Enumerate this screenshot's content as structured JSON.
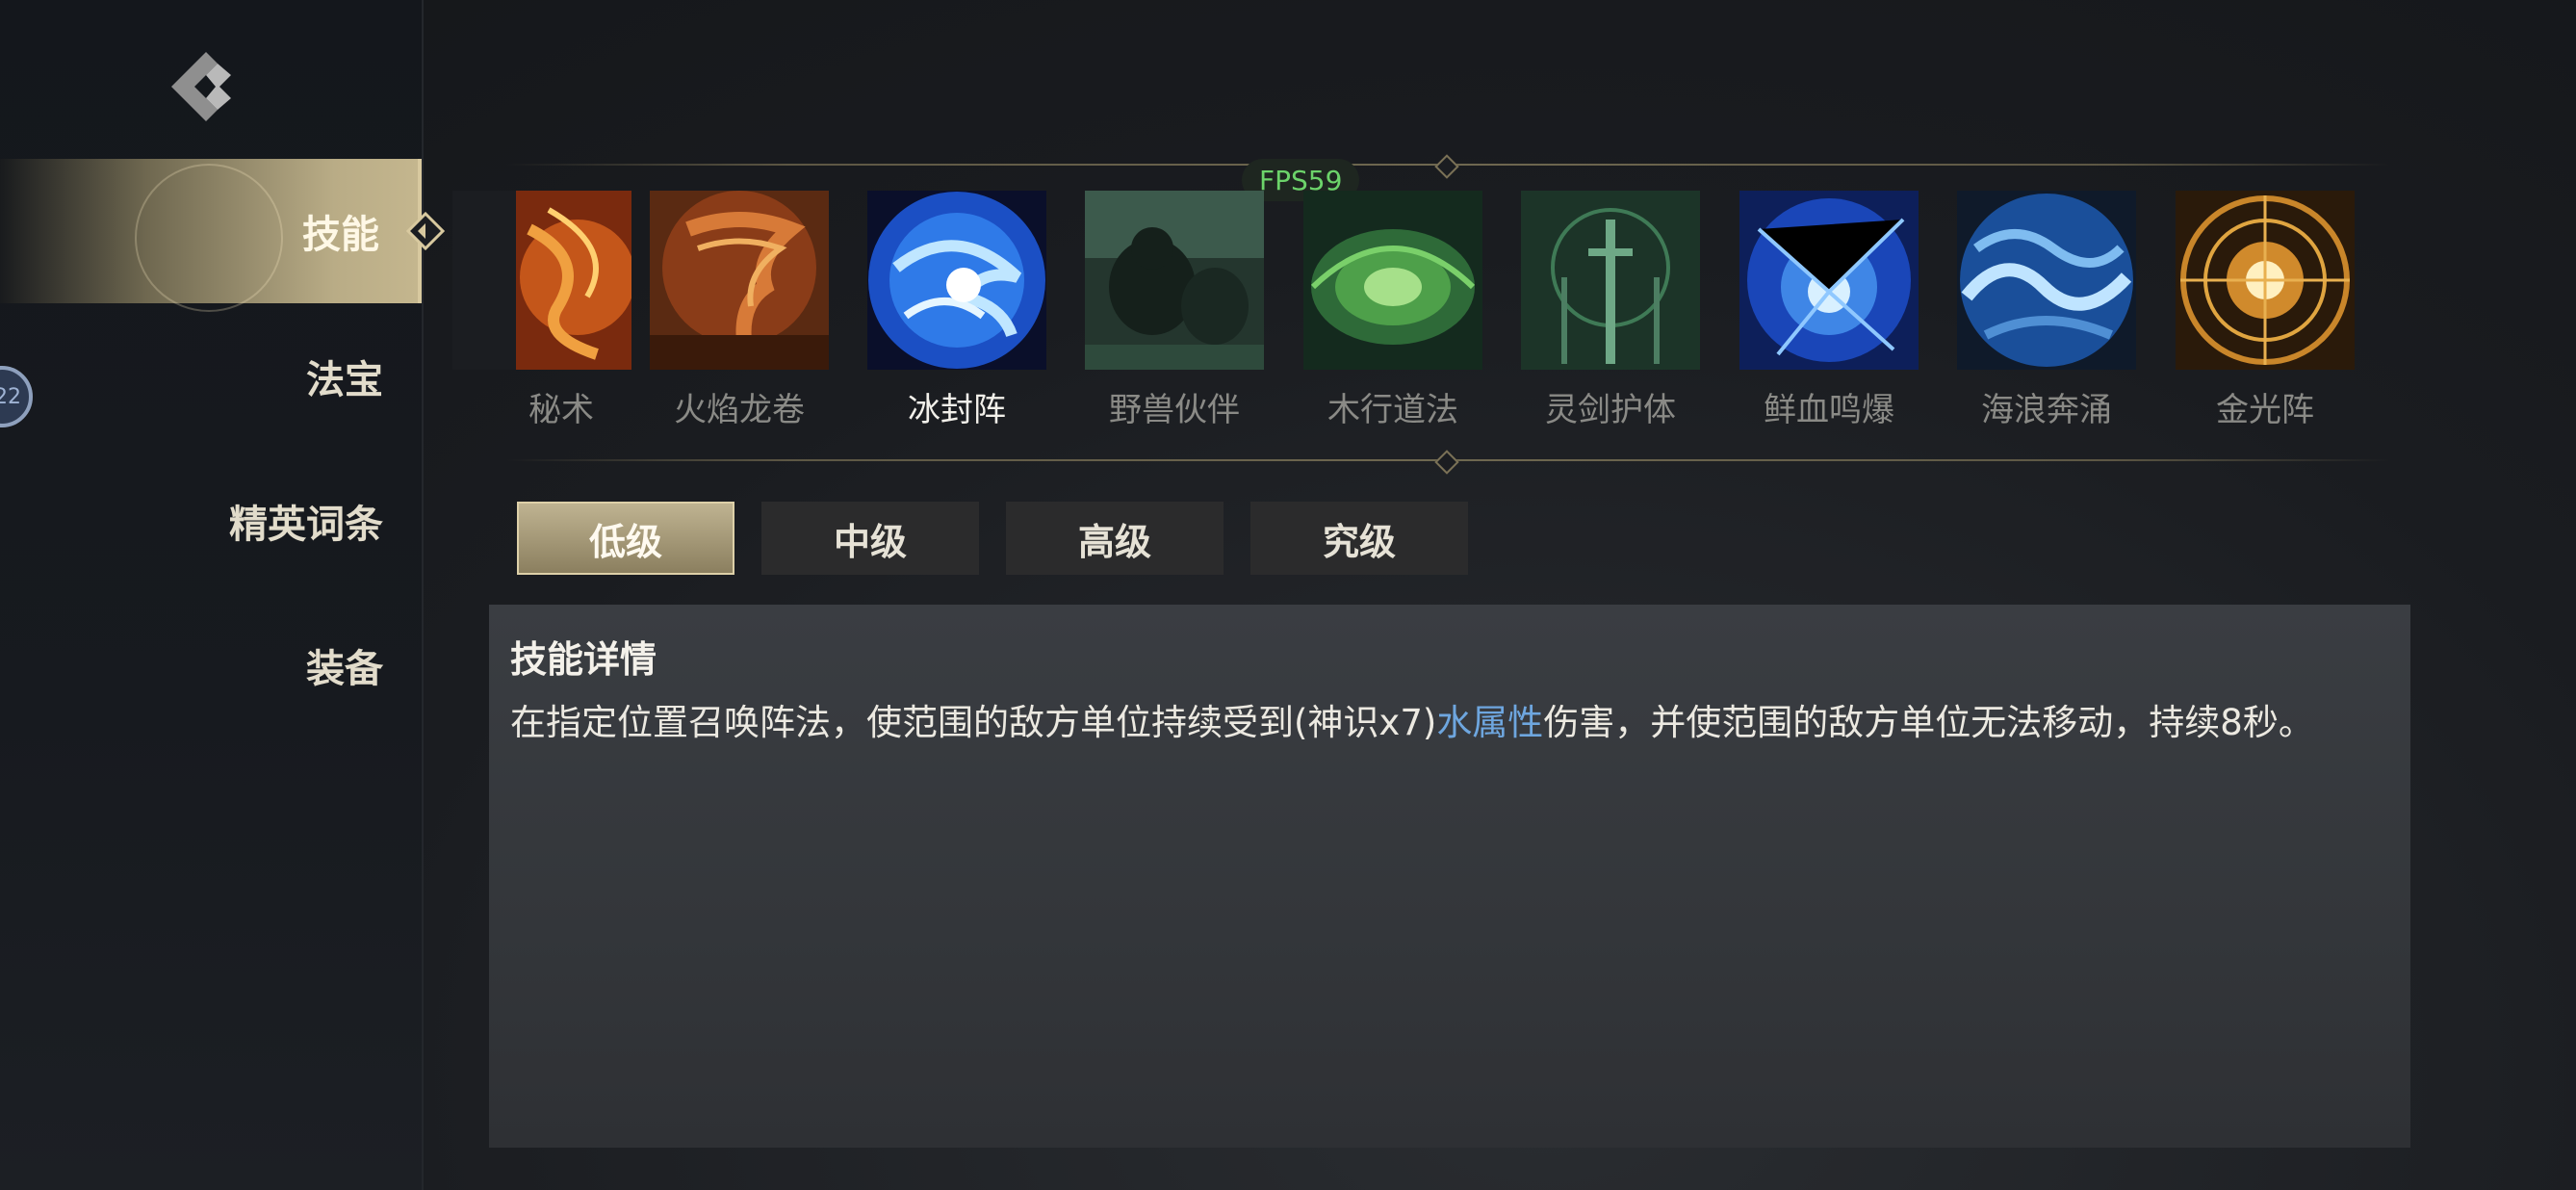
{
  "overlay": {
    "fps": "FPS59"
  },
  "sidebar": {
    "badge": "22",
    "items": [
      {
        "label": "技能",
        "active": true
      },
      {
        "label": "法宝",
        "active": false
      },
      {
        "label": "精英词条",
        "active": false
      },
      {
        "label": "装备",
        "active": false
      }
    ]
  },
  "skills": [
    {
      "name": "秘术",
      "icon": "fire-swirl-art",
      "selected": false
    },
    {
      "name": "火焰龙卷",
      "icon": "fire-tornado-art",
      "selected": false
    },
    {
      "name": "冰封阵",
      "icon": "ice-vortex-art",
      "selected": true
    },
    {
      "name": "野兽伙伴",
      "icon": "beast-companion-art",
      "selected": false
    },
    {
      "name": "木行道法",
      "icon": "wood-circle-art",
      "selected": false
    },
    {
      "name": "灵剑护体",
      "icon": "spirit-swords-art",
      "selected": false
    },
    {
      "name": "鲜血鸣爆",
      "icon": "blue-burst-art",
      "selected": false
    },
    {
      "name": "海浪奔涌",
      "icon": "wave-orb-art",
      "selected": false
    },
    {
      "name": "金光阵",
      "icon": "golden-rune-art",
      "selected": false
    }
  ],
  "tiers": [
    {
      "label": "低级",
      "active": true
    },
    {
      "label": "中级",
      "active": false
    },
    {
      "label": "高级",
      "active": false
    },
    {
      "label": "究级",
      "active": false
    }
  ],
  "detail": {
    "title": "技能详情",
    "desc_before": "在指定位置召唤阵法，使范围的敌方单位持续受到(神识x7)",
    "desc_highlight": "水属性",
    "desc_after": "伤害，并使范围的敌方单位无法移动，持续8秒。",
    "highlight_color": "#6ea6df"
  }
}
